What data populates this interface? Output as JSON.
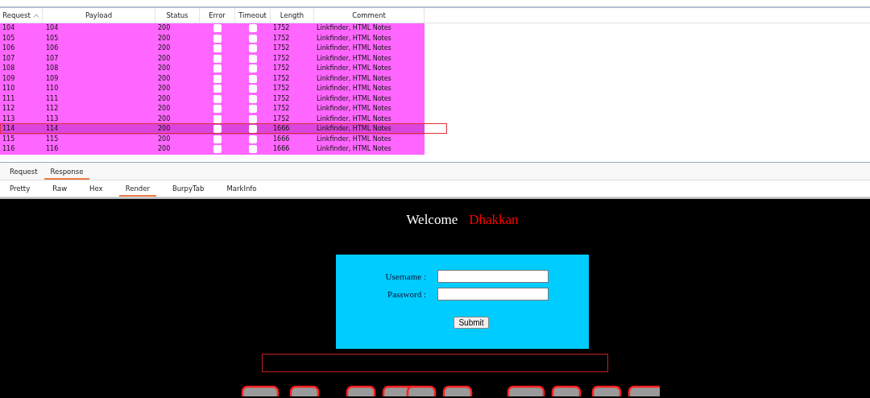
{
  "results_table": {
    "columns": [
      {
        "label": "Request",
        "sorted": true
      },
      {
        "label": "Payload",
        "sorted": false
      },
      {
        "label": "Status",
        "sorted": false
      },
      {
        "label": "Error",
        "sorted": false
      },
      {
        "label": "Timeout",
        "sorted": false
      },
      {
        "label": "Length",
        "sorted": false
      },
      {
        "label": "Comment",
        "sorted": false
      }
    ],
    "rows": [
      {
        "request": "104",
        "payload": "104",
        "status": "200",
        "error": false,
        "timeout": false,
        "length": "1752",
        "comment": "Linkfinder, HTML Notes",
        "selected": false
      },
      {
        "request": "105",
        "payload": "105",
        "status": "200",
        "error": false,
        "timeout": false,
        "length": "1752",
        "comment": "Linkfinder, HTML Notes",
        "selected": false
      },
      {
        "request": "106",
        "payload": "106",
        "status": "200",
        "error": false,
        "timeout": false,
        "length": "1752",
        "comment": "Linkfinder, HTML Notes",
        "selected": false
      },
      {
        "request": "107",
        "payload": "107",
        "status": "200",
        "error": false,
        "timeout": false,
        "length": "1752",
        "comment": "Linkfinder, HTML Notes",
        "selected": false
      },
      {
        "request": "108",
        "payload": "108",
        "status": "200",
        "error": false,
        "timeout": false,
        "length": "1752",
        "comment": "Linkfinder, HTML Notes",
        "selected": false
      },
      {
        "request": "109",
        "payload": "109",
        "status": "200",
        "error": false,
        "timeout": false,
        "length": "1752",
        "comment": "Linkfinder, HTML Notes",
        "selected": false
      },
      {
        "request": "110",
        "payload": "110",
        "status": "200",
        "error": false,
        "timeout": false,
        "length": "1752",
        "comment": "Linkfinder, HTML Notes",
        "selected": false
      },
      {
        "request": "111",
        "payload": "111",
        "status": "200",
        "error": false,
        "timeout": false,
        "length": "1752",
        "comment": "Linkfinder, HTML Notes",
        "selected": false
      },
      {
        "request": "112",
        "payload": "112",
        "status": "200",
        "error": false,
        "timeout": false,
        "length": "1752",
        "comment": "Linkfinder, HTML Notes",
        "selected": false
      },
      {
        "request": "113",
        "payload": "113",
        "status": "200",
        "error": false,
        "timeout": false,
        "length": "1752",
        "comment": "Linkfinder, HTML Notes",
        "selected": false
      },
      {
        "request": "114",
        "payload": "114",
        "status": "200",
        "error": false,
        "timeout": false,
        "length": "1666",
        "comment": "Linkfinder, HTML Notes",
        "selected": true
      },
      {
        "request": "115",
        "payload": "115",
        "status": "200",
        "error": false,
        "timeout": false,
        "length": "1666",
        "comment": "Linkfinder, HTML Notes",
        "selected": false
      },
      {
        "request": "116",
        "payload": "116",
        "status": "200",
        "error": false,
        "timeout": false,
        "length": "1666",
        "comment": "Linkfinder, HTML Notes",
        "selected": false
      }
    ]
  },
  "message_tabs": [
    {
      "label": "Request",
      "selected": false
    },
    {
      "label": "Response",
      "selected": true
    }
  ],
  "view_tabs": [
    {
      "label": "Pretty",
      "selected": false
    },
    {
      "label": "Raw",
      "selected": false
    },
    {
      "label": "Hex",
      "selected": false
    },
    {
      "label": "Render",
      "selected": true
    },
    {
      "label": "BurpyTab",
      "selected": false
    },
    {
      "label": "MarkInfo",
      "selected": false
    }
  ],
  "render": {
    "welcome": "Welcome",
    "name": "Dhakkan",
    "form": {
      "username_label": "Username :",
      "password_label": "Password :",
      "submit": "Submit"
    }
  }
}
